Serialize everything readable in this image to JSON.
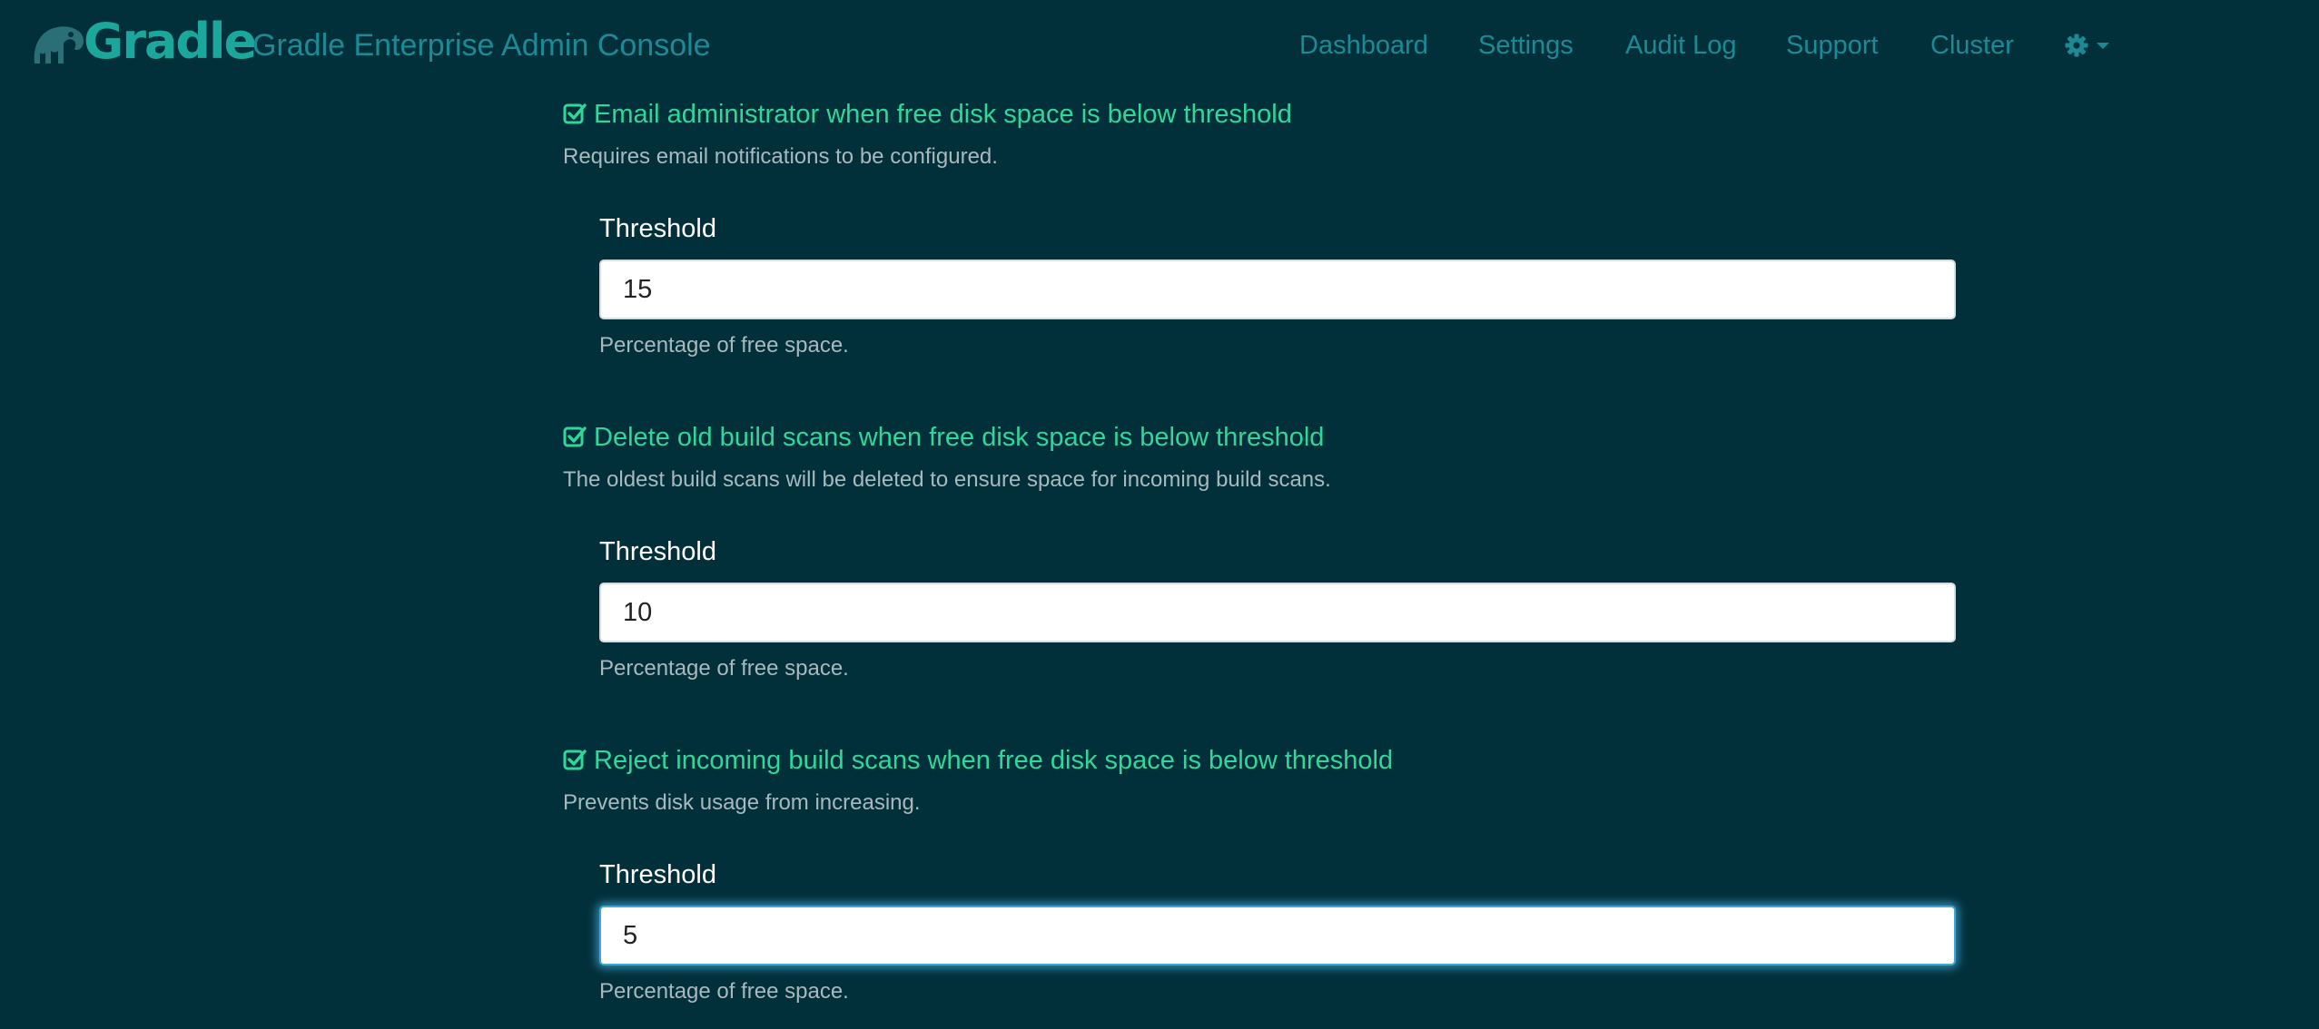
{
  "brand": {
    "logo_text": "Gradle",
    "console_title": "Gradle Enterprise Admin Console",
    "accent_color": "#1ba79b"
  },
  "nav": {
    "items": [
      {
        "label": "Dashboard"
      },
      {
        "label": "Settings"
      },
      {
        "label": "Audit Log"
      },
      {
        "label": "Support"
      },
      {
        "label": "Cluster"
      }
    ],
    "settings_menu_icon": "gear-icon"
  },
  "settings": [
    {
      "checked": true,
      "title": "Email administrator when free disk space is below threshold",
      "description": "Requires email notifications to be configured.",
      "field_label": "Threshold",
      "value": "15",
      "help": "Percentage of free space."
    },
    {
      "checked": true,
      "title": "Delete old build scans when free disk space is below threshold",
      "description": "The oldest build scans will be deleted to ensure space for incoming build scans.",
      "field_label": "Threshold",
      "value": "10",
      "help": "Percentage of free space."
    },
    {
      "checked": true,
      "title": "Reject incoming build scans when free disk space is below threshold",
      "description": "Prevents disk usage from increasing.",
      "field_label": "Threshold",
      "value": "5",
      "help": "Percentage of free space."
    }
  ],
  "colors": {
    "background": "#02303a",
    "nav_link": "#1c8a95",
    "setting_title": "#31d69b",
    "muted_text": "#a8b9bd",
    "focus_ring": "#3fa7d6"
  }
}
